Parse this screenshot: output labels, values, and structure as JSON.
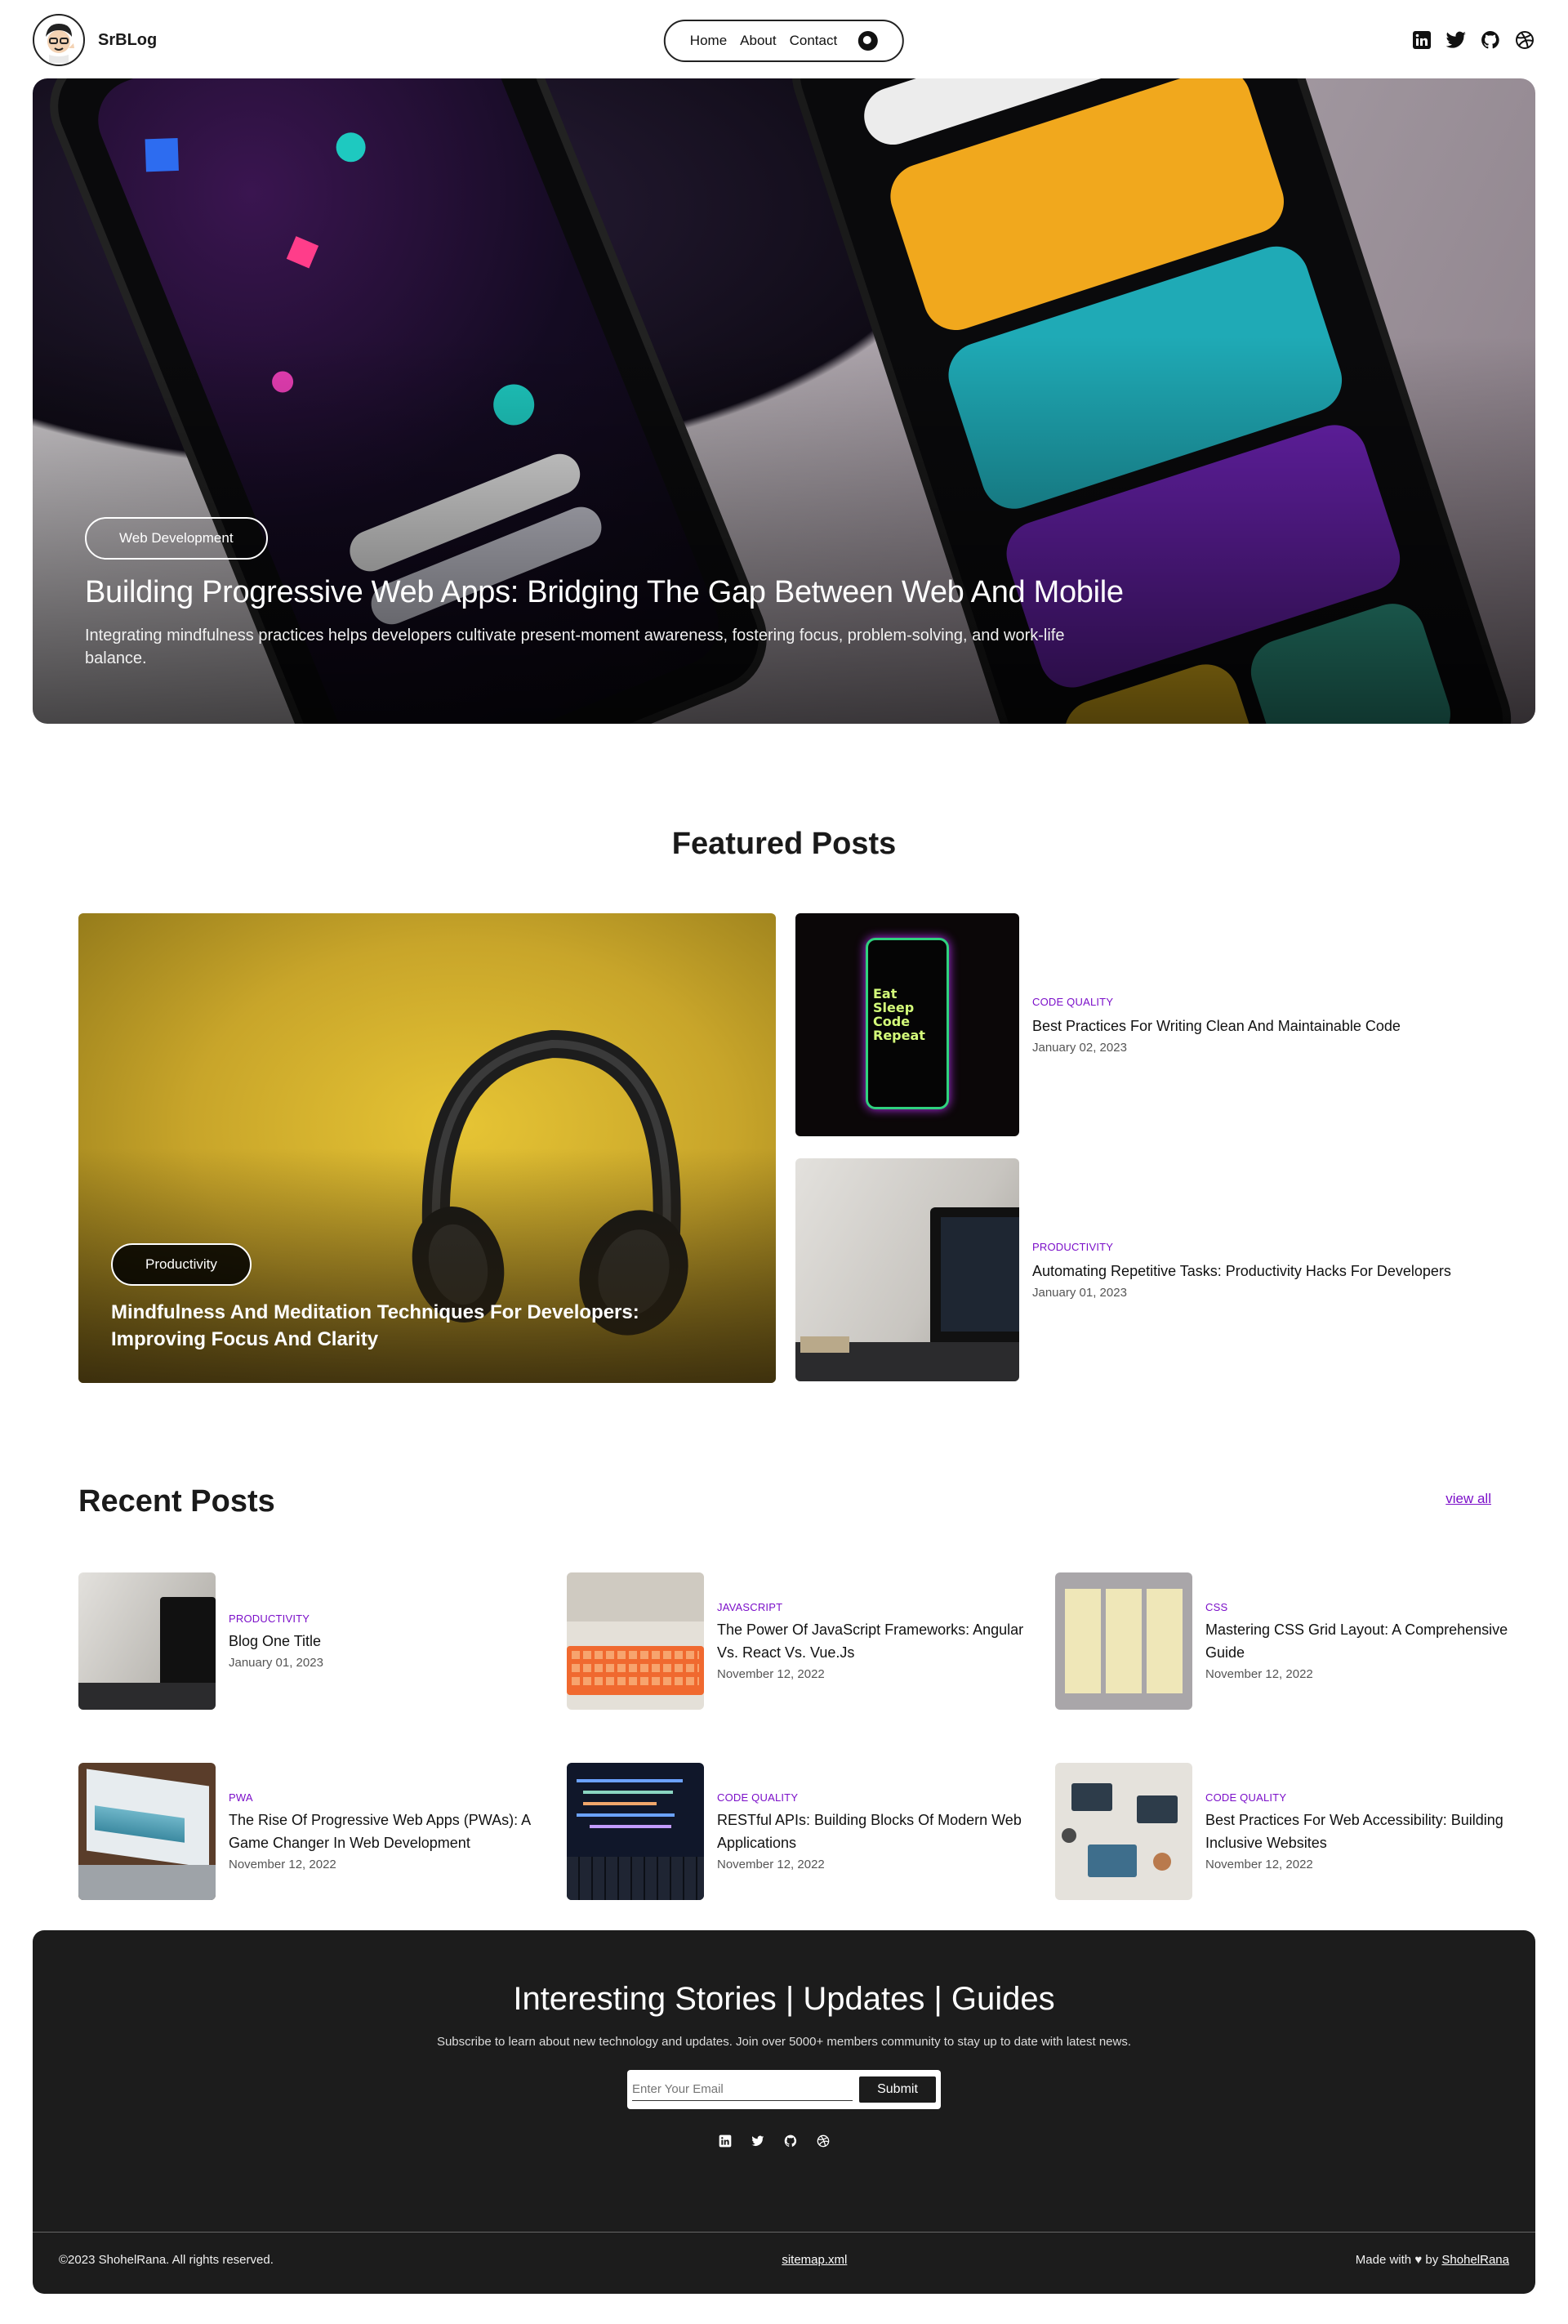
{
  "brand": {
    "name": "SrBLog"
  },
  "nav": {
    "items": [
      "Home",
      "About",
      "Contact"
    ]
  },
  "social": [
    "linkedin-icon",
    "twitter-icon",
    "github-icon",
    "dribbble-icon"
  ],
  "hero": {
    "category": "Web Development",
    "title": "Building Progressive Web Apps: Bridging The Gap Between Web And Mobile",
    "description": "Integrating mindfulness practices helps developers cultivate present-moment awareness, fostering focus, problem-solving, and work-life balance."
  },
  "featured": {
    "heading": "Featured Posts",
    "main": {
      "category": "Productivity",
      "title": "Mindfulness And Meditation Techniques For Developers: Improving Focus And Clarity"
    },
    "side": [
      {
        "category": "Code Quality",
        "title": "Best Practices For Writing Clean And Maintainable Code",
        "date": "January 02, 2023"
      },
      {
        "category": "Productivity",
        "title": "Automating Repetitive Tasks: Productivity Hacks For Developers",
        "date": "January 01, 2023"
      }
    ]
  },
  "recent": {
    "heading": "Recent Posts",
    "view_all": "view all",
    "posts": [
      {
        "category": "Productivity",
        "title": "Blog One Title",
        "date": "January 01, 2023"
      },
      {
        "category": "JavaScript",
        "title": "The Power Of JavaScript Frameworks: Angular Vs. React Vs. Vue.Js",
        "date": "November 12, 2022"
      },
      {
        "category": "CSS",
        "title": "Mastering CSS Grid Layout: A Comprehensive Guide",
        "date": "November 12, 2022"
      },
      {
        "category": "PWA",
        "title": "The Rise Of Progressive Web Apps (PWAs): A Game Changer In Web Development",
        "date": "November 12, 2022"
      },
      {
        "category": "Code Quality",
        "title": "RESTful APIs: Building Blocks Of Modern Web Applications",
        "date": "November 12, 2022"
      },
      {
        "category": "Code Quality",
        "title": "Best Practices For Web Accessibility: Building Inclusive Websites",
        "date": "November 12, 2022"
      }
    ]
  },
  "newsletter": {
    "title": "Interesting Stories | Updates | Guides",
    "subtitle": "Subscribe to learn about new technology and updates. Join over 5000+ members community to stay up to date with latest news.",
    "placeholder": "Enter Your Email",
    "button": "Submit"
  },
  "footer": {
    "copyright": "©2023 ShohelRana. All rights reserved.",
    "sitemap": "sitemap.xml",
    "made_with_prefix": "Made with ♥ by ",
    "author": "ShohelRana"
  },
  "colors": {
    "accent": "#7b0fc9",
    "dark": "#1c1c1c",
    "featured_bg": "#d7b52e"
  }
}
